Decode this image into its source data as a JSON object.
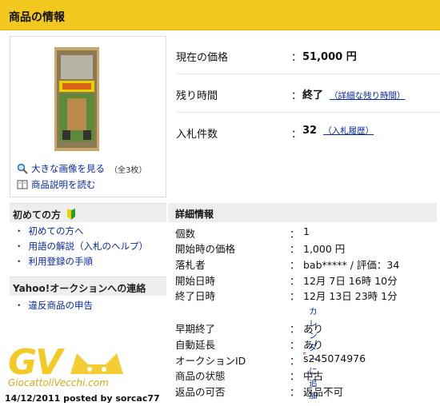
{
  "header": {
    "title": "商品の情報"
  },
  "image_panel": {
    "big_image_link": "大きな画像を見る",
    "image_count": "（全3枚）",
    "description_link": "商品説明を読む"
  },
  "summary": {
    "price_label": "現在の価格",
    "price_value": "51,000 円",
    "time_label": "残り時間",
    "time_value": "終了",
    "time_detail_link": "（詳細な残り時間）",
    "bids_label": "入札件数",
    "bids_value": "32",
    "bid_history_link": "（入札履歴）",
    "colon": "："
  },
  "beginners": {
    "title": "初めての方",
    "items": [
      "初めての方へ",
      "用語の解説（入札のヘルプ）",
      "利用登録の手順"
    ]
  },
  "contact": {
    "title": "Yahoo!オークションへの連絡",
    "items": [
      "違反商品の申告"
    ]
  },
  "details": {
    "title": "詳細情報",
    "rows": [
      {
        "label": "個数",
        "value": "1"
      },
      {
        "label": "開始時の価格",
        "value": "1,000 円"
      },
      {
        "label": "落札者",
        "value": "bab***** / 評価：34"
      },
      {
        "label": "開始日時",
        "value": "12月 7日 16時 10分"
      },
      {
        "label": "終了日時",
        "value": "12月 13日 23時 1分"
      },
      {
        "label": "早期終了",
        "value": "あり"
      },
      {
        "label": "自動延長",
        "value": "あり"
      },
      {
        "label": "オークションID",
        "value": "s245074976"
      },
      {
        "label": "商品の状態",
        "value": "中古"
      },
      {
        "label": "返品の可否",
        "value": "返品不可"
      }
    ],
    "calendar_link": "カレンダーに追加"
  },
  "watermark": {
    "logo": "GV",
    "site": "GiocattoliVecchi.com",
    "caption": "14/12/2011 posted by sorcac77"
  },
  "colors": {
    "header_bg": "#f2c81e",
    "link": "#0a2aa0",
    "section_bg": "#eeeeee"
  },
  "icons": [
    "magnifier-icon",
    "book-icon",
    "beginner-mark-icon",
    "calendar-icon"
  ]
}
